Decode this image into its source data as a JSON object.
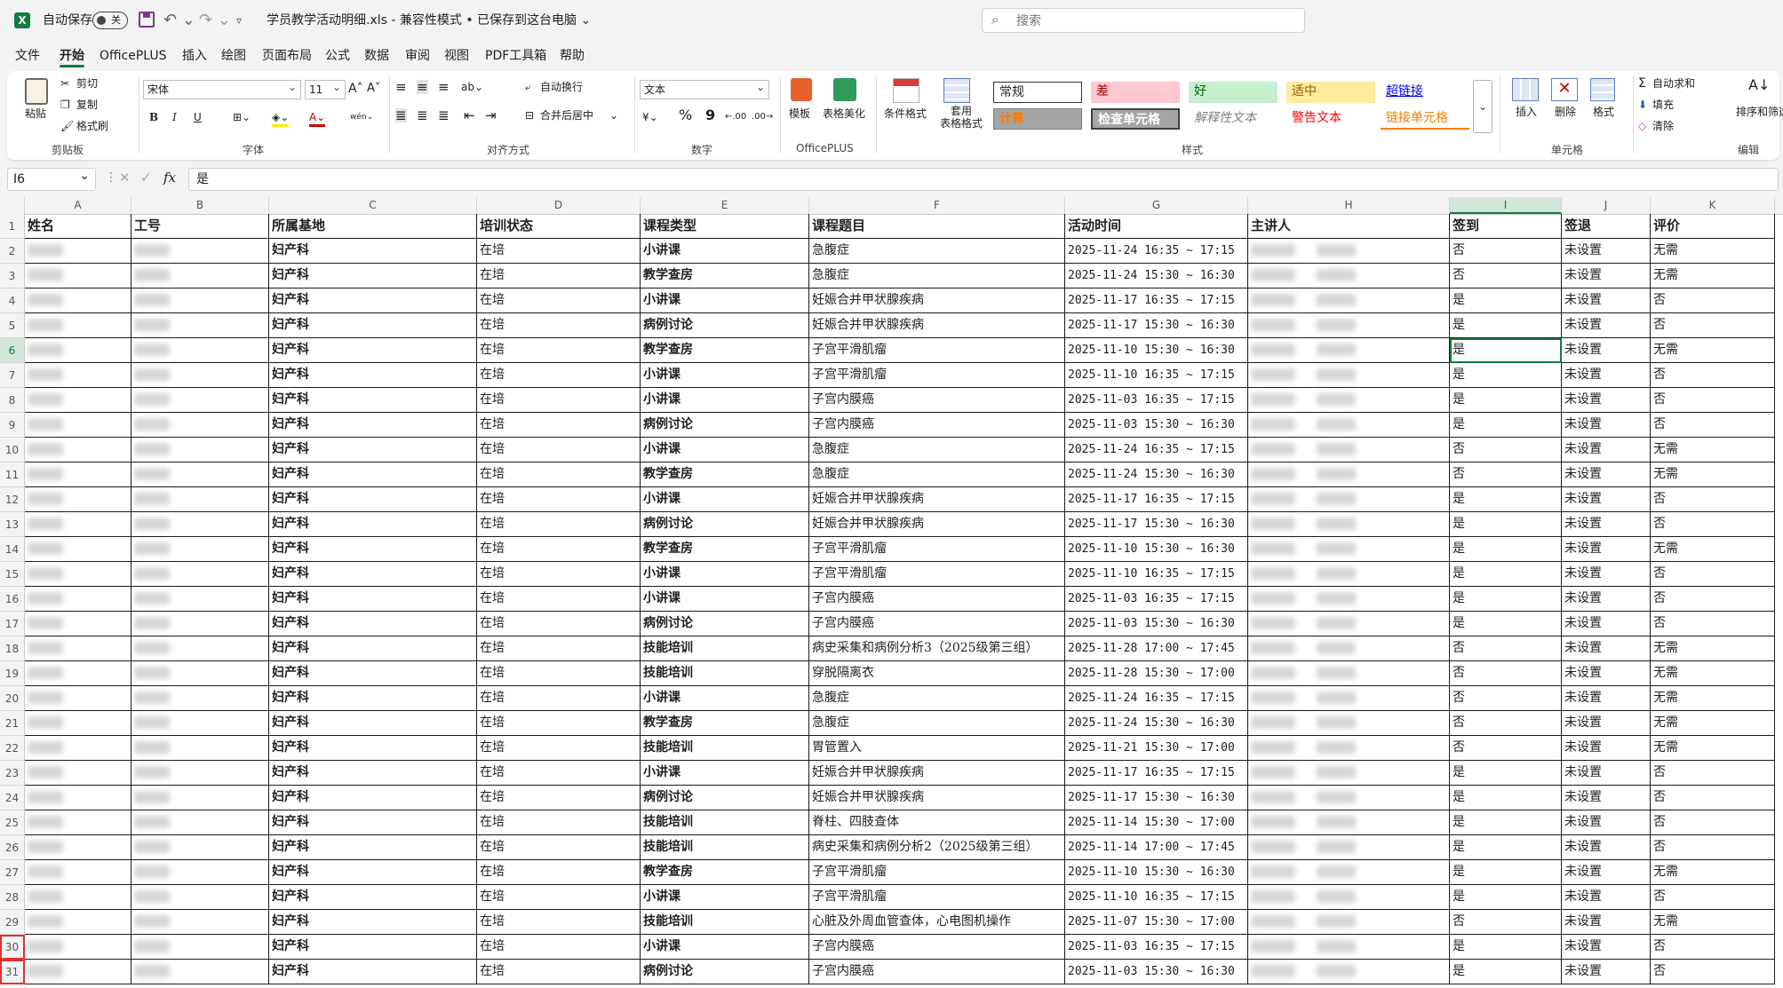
{
  "titlebar": {
    "excel_icon": "X",
    "autosave_label": "自动保存",
    "autosave_state": "关",
    "doc_title": "学员教学活动明细.xls  -  兼容性模式 • 已保存到这台电脑 ⌄",
    "search_placeholder": "搜索"
  },
  "menu": [
    "文件",
    "开始",
    "OfficePLUS",
    "插入",
    "绘图",
    "页面布局",
    "公式",
    "数据",
    "审阅",
    "视图",
    "PDF工具箱",
    "帮助"
  ],
  "ribbon": {
    "clipboard": {
      "paste": "粘贴",
      "cut": "剪切",
      "copy": "复制",
      "format_painter": "格式刷",
      "group": "剪贴板"
    },
    "font": {
      "name": "宋体",
      "size": "11",
      "bold": "B",
      "italic": "I",
      "underline": "U",
      "group": "字体"
    },
    "align": {
      "wrap": "自动换行",
      "merge": "合并后居中",
      "group": "对齐方式"
    },
    "number": {
      "format": "文本",
      "percent": "%",
      "comma": "9",
      "group": "数字"
    },
    "officeplus": {
      "template": "模板",
      "beautify": "表格美化",
      "group": "OfficePLUS"
    },
    "styles": {
      "conditional": "条件格式",
      "table_format": "套用\n表格格式",
      "normal": "常规",
      "bad": "差",
      "good": "好",
      "neutral": "适中",
      "hyperlink": "超链接",
      "calc": "计算",
      "check": "检查单元格",
      "explain": "解释性文本",
      "warn": "警告文本",
      "linked": "链接单元格",
      "group": "样式"
    },
    "cells": {
      "insert": "插入",
      "delete": "删除",
      "format": "格式",
      "group": "单元格"
    },
    "editing": {
      "autosum": "自动求和",
      "fill": "填充",
      "clear": "清除",
      "sort": "排序和筛选",
      "group": "编辑"
    }
  },
  "formula": {
    "namebox": "I6",
    "content": "是"
  },
  "columns": [
    "A",
    "B",
    "C",
    "D",
    "E",
    "F",
    "G",
    "H",
    "I",
    "J",
    "K"
  ],
  "header_row": [
    "姓名",
    "工号",
    "所属基地",
    "培训状态",
    "课程类型",
    "课程题目",
    "活动时间",
    "主讲人",
    "签到",
    "签退",
    "评价"
  ],
  "rows": [
    [
      "妇产科",
      "在培",
      "小讲课",
      "急腹症",
      "2025-11-24 16:35 ~ 17:15",
      "否",
      "未设置",
      "无需"
    ],
    [
      "妇产科",
      "在培",
      "教学查房",
      "急腹症",
      "2025-11-24 15:30 ~ 16:30",
      "否",
      "未设置",
      "无需"
    ],
    [
      "妇产科",
      "在培",
      "小讲课",
      "妊娠合并甲状腺疾病",
      "2025-11-17 16:35 ~ 17:15",
      "是",
      "未设置",
      "否"
    ],
    [
      "妇产科",
      "在培",
      "病例讨论",
      "妊娠合并甲状腺疾病",
      "2025-11-17 15:30 ~ 16:30",
      "是",
      "未设置",
      "否"
    ],
    [
      "妇产科",
      "在培",
      "教学查房",
      "子宫平滑肌瘤",
      "2025-11-10 15:30 ~ 16:30",
      "是",
      "未设置",
      "无需"
    ],
    [
      "妇产科",
      "在培",
      "小讲课",
      "子宫平滑肌瘤",
      "2025-11-10 16:35 ~ 17:15",
      "是",
      "未设置",
      "否"
    ],
    [
      "妇产科",
      "在培",
      "小讲课",
      "子宫内膜癌",
      "2025-11-03 16:35 ~ 17:15",
      "是",
      "未设置",
      "否"
    ],
    [
      "妇产科",
      "在培",
      "病例讨论",
      "子宫内膜癌",
      "2025-11-03 15:30 ~ 16:30",
      "是",
      "未设置",
      "否"
    ],
    [
      "妇产科",
      "在培",
      "小讲课",
      "急腹症",
      "2025-11-24 16:35 ~ 17:15",
      "否",
      "未设置",
      "无需"
    ],
    [
      "妇产科",
      "在培",
      "教学查房",
      "急腹症",
      "2025-11-24 15:30 ~ 16:30",
      "否",
      "未设置",
      "无需"
    ],
    [
      "妇产科",
      "在培",
      "小讲课",
      "妊娠合并甲状腺疾病",
      "2025-11-17 16:35 ~ 17:15",
      "是",
      "未设置",
      "否"
    ],
    [
      "妇产科",
      "在培",
      "病例讨论",
      "妊娠合并甲状腺疾病",
      "2025-11-17 15:30 ~ 16:30",
      "是",
      "未设置",
      "否"
    ],
    [
      "妇产科",
      "在培",
      "教学查房",
      "子宫平滑肌瘤",
      "2025-11-10 15:30 ~ 16:30",
      "是",
      "未设置",
      "无需"
    ],
    [
      "妇产科",
      "在培",
      "小讲课",
      "子宫平滑肌瘤",
      "2025-11-10 16:35 ~ 17:15",
      "是",
      "未设置",
      "否"
    ],
    [
      "妇产科",
      "在培",
      "小讲课",
      "子宫内膜癌",
      "2025-11-03 16:35 ~ 17:15",
      "是",
      "未设置",
      "否"
    ],
    [
      "妇产科",
      "在培",
      "病例讨论",
      "子宫内膜癌",
      "2025-11-03 15:30 ~ 16:30",
      "是",
      "未设置",
      "否"
    ],
    [
      "妇产科",
      "在培",
      "技能培训",
      "病史采集和病例分析3（2025级第三组）",
      "2025-11-28 17:00 ~ 17:45",
      "否",
      "未设置",
      "无需"
    ],
    [
      "妇产科",
      "在培",
      "技能培训",
      "穿脱隔离衣",
      "2025-11-28 15:30 ~ 17:00",
      "否",
      "未设置",
      "无需"
    ],
    [
      "妇产科",
      "在培",
      "小讲课",
      "急腹症",
      "2025-11-24 16:35 ~ 17:15",
      "否",
      "未设置",
      "无需"
    ],
    [
      "妇产科",
      "在培",
      "教学查房",
      "急腹症",
      "2025-11-24 15:30 ~ 16:30",
      "否",
      "未设置",
      "无需"
    ],
    [
      "妇产科",
      "在培",
      "技能培训",
      "胃管置入",
      "2025-11-21 15:30 ~ 17:00",
      "否",
      "未设置",
      "无需"
    ],
    [
      "妇产科",
      "在培",
      "小讲课",
      "妊娠合并甲状腺疾病",
      "2025-11-17 16:35 ~ 17:15",
      "是",
      "未设置",
      "否"
    ],
    [
      "妇产科",
      "在培",
      "病例讨论",
      "妊娠合并甲状腺疾病",
      "2025-11-17 15:30 ~ 16:30",
      "是",
      "未设置",
      "否"
    ],
    [
      "妇产科",
      "在培",
      "技能培训",
      "脊柱、四肢查体",
      "2025-11-14 15:30 ~ 17:00",
      "是",
      "未设置",
      "否"
    ],
    [
      "妇产科",
      "在培",
      "技能培训",
      "病史采集和病例分析2（2025级第三组）",
      "2025-11-14 17:00 ~ 17:45",
      "是",
      "未设置",
      "否"
    ],
    [
      "妇产科",
      "在培",
      "教学查房",
      "子宫平滑肌瘤",
      "2025-11-10 15:30 ~ 16:30",
      "是",
      "未设置",
      "无需"
    ],
    [
      "妇产科",
      "在培",
      "小讲课",
      "子宫平滑肌瘤",
      "2025-11-10 16:35 ~ 17:15",
      "是",
      "未设置",
      "否"
    ],
    [
      "妇产科",
      "在培",
      "技能培训",
      "心脏及外周血管查体，心电图机操作",
      "2025-11-07 15:30 ~ 17:00",
      "否",
      "未设置",
      "无需"
    ],
    [
      "妇产科",
      "在培",
      "小讲课",
      "子宫内膜癌",
      "2025-11-03 16:35 ~ 17:15",
      "是",
      "未设置",
      "否"
    ],
    [
      "妇产科",
      "在培",
      "病例讨论",
      "子宫内膜癌",
      "2025-11-03 15:30 ~ 16:30",
      "是",
      "未设置",
      "否"
    ]
  ],
  "colors": {
    "accent": "#107c41",
    "highlight_rows": "#e03030"
  }
}
